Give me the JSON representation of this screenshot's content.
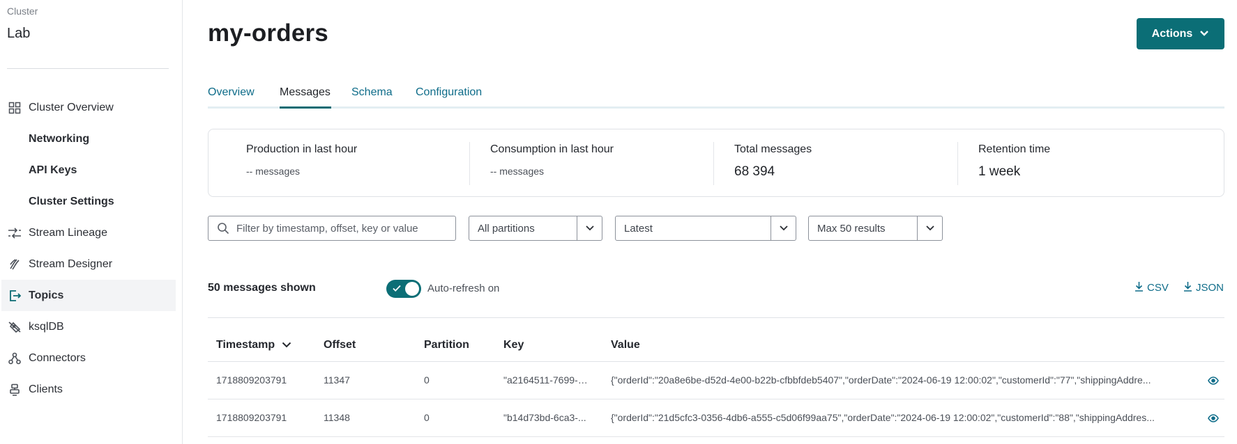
{
  "sidebar": {
    "cluster_label": "Cluster",
    "cluster_name": "Lab",
    "items": [
      {
        "label": "Cluster Overview",
        "icon": "grid-icon"
      },
      {
        "label": "Networking",
        "icon": ""
      },
      {
        "label": "API Keys",
        "icon": ""
      },
      {
        "label": "Cluster Settings",
        "icon": ""
      },
      {
        "label": "Stream Lineage",
        "icon": "lineage-icon"
      },
      {
        "label": "Stream Designer",
        "icon": "designer-icon"
      },
      {
        "label": "Topics",
        "icon": "topics-icon"
      },
      {
        "label": "ksqlDB",
        "icon": "ksqldb-icon"
      },
      {
        "label": "Connectors",
        "icon": "connectors-icon"
      },
      {
        "label": "Clients",
        "icon": "clients-icon"
      }
    ]
  },
  "header": {
    "title": "my-orders",
    "actions_label": "Actions"
  },
  "tabs": [
    {
      "label": "Overview"
    },
    {
      "label": "Messages",
      "active": true
    },
    {
      "label": "Schema"
    },
    {
      "label": "Configuration"
    }
  ],
  "stats": [
    {
      "label": "Production in last hour",
      "value_prefix": "--",
      "value": "messages"
    },
    {
      "label": "Consumption in last hour",
      "value_prefix": "--",
      "value": "messages"
    },
    {
      "label": "Total messages",
      "value": "68 394"
    },
    {
      "label": "Retention time",
      "value": "1 week"
    }
  ],
  "filters": {
    "search_placeholder": "Filter by timestamp, offset, key or value",
    "partitions": "All partitions",
    "offset": "Latest",
    "limit": "Max 50 results"
  },
  "messages": {
    "shown_count": "50 messages shown",
    "auto_refresh_label": "Auto-refresh on",
    "auto_refresh_on": true,
    "download_csv": "CSV",
    "download_json": "JSON"
  },
  "table": {
    "columns": [
      "Timestamp",
      "Offset",
      "Partition",
      "Key",
      "Value"
    ],
    "rows": [
      {
        "timestamp": "1718809203791",
        "offset": "11347",
        "partition": "0",
        "key": "\"a2164511-7699-4...",
        "value": "{\"orderId\":\"20a8e6be-d52d-4e00-b22b-cfbbfdeb5407\",\"orderDate\":\"2024-06-19 12:00:02\",\"customerId\":\"77\",\"shippingAddre..."
      },
      {
        "timestamp": "1718809203791",
        "offset": "11348",
        "partition": "0",
        "key": "\"b14d73bd-6ca3-...",
        "value": "{\"orderId\":\"21d5cfc3-0356-4db6-a555-c5d06f99aa75\",\"orderDate\":\"2024-06-19 12:00:02\",\"customerId\":\"88\",\"shippingAddres..."
      }
    ]
  },
  "colors": {
    "accent": "#0b6e76",
    "link": "#0e6c89"
  }
}
